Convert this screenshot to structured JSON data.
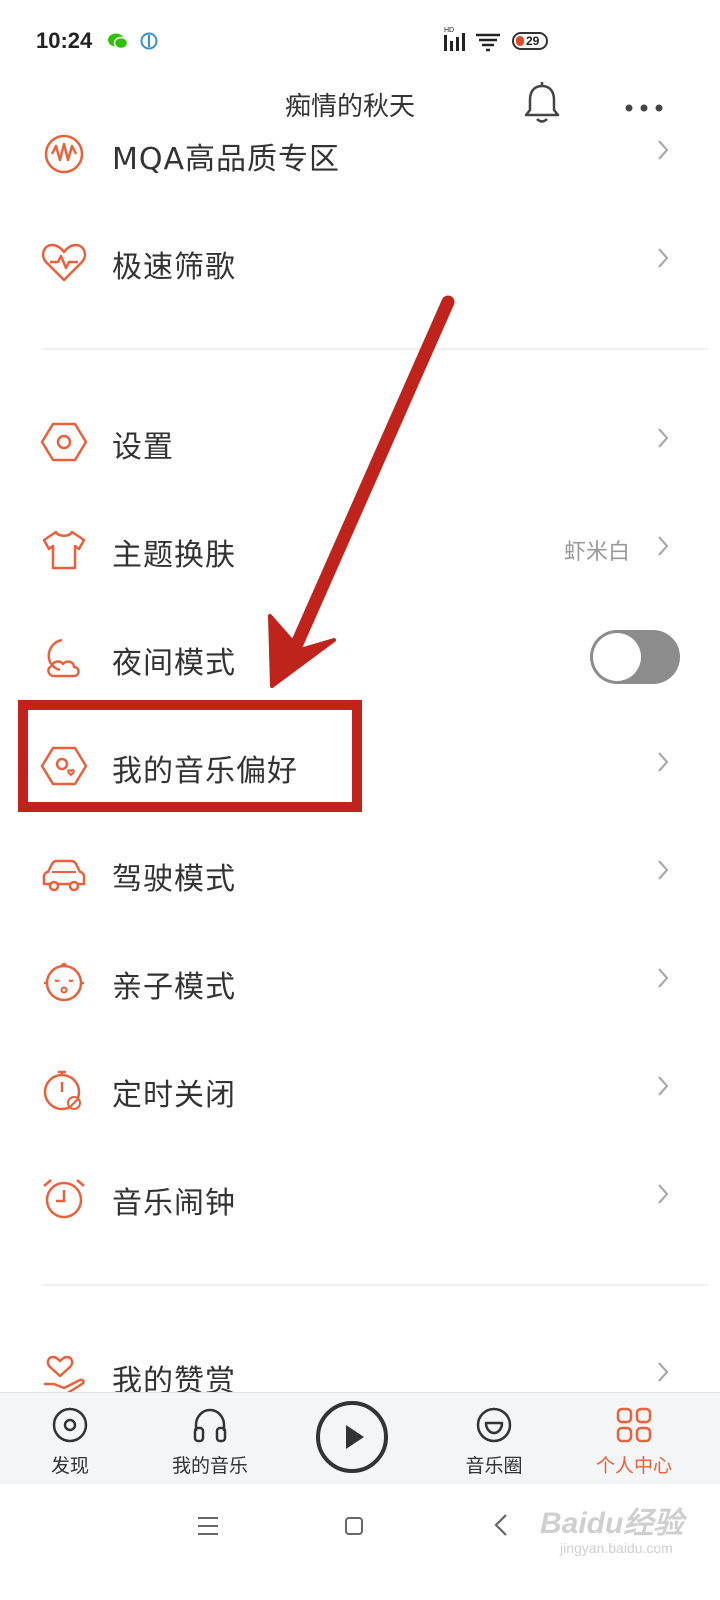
{
  "status_bar": {
    "time": "10:24",
    "battery": "29"
  },
  "header": {
    "title": "痴情的秋天"
  },
  "list": {
    "items": [
      {
        "label": "MQA高品质专区",
        "icon": "mqa-icon"
      },
      {
        "label": "极速筛歌",
        "icon": "heartbeat-icon"
      },
      {
        "label": "设置",
        "icon": "settings-hexagon-icon"
      },
      {
        "label": "主题换肤",
        "icon": "tshirt-icon",
        "value": "虾米白"
      },
      {
        "label": "夜间模式",
        "icon": "moon-cloud-icon",
        "toggle": "off"
      },
      {
        "label": "我的音乐偏好",
        "icon": "music-preference-icon"
      },
      {
        "label": "驾驶模式",
        "icon": "car-icon"
      },
      {
        "label": "亲子模式",
        "icon": "baby-face-icon"
      },
      {
        "label": "定时关闭",
        "icon": "timer-icon"
      },
      {
        "label": "音乐闹钟",
        "icon": "alarm-clock-icon"
      },
      {
        "label": "我的赞赏",
        "icon": "appreciation-icon"
      }
    ]
  },
  "bottom_nav": {
    "items": [
      {
        "label": "发现",
        "icon": "disc-icon"
      },
      {
        "label": "我的音乐",
        "icon": "headphones-icon"
      },
      {
        "label": "音乐圈",
        "icon": "smile-icon"
      },
      {
        "label": "个人中心",
        "icon": "grid-icon",
        "active": true
      }
    ]
  },
  "watermark": {
    "text": "Baidu经验",
    "sub": "jingyan.baidu.com"
  },
  "colors": {
    "accent": "#e8613c",
    "highlight": "#c0221c",
    "text": "#333333",
    "secondary_text": "#999999"
  }
}
